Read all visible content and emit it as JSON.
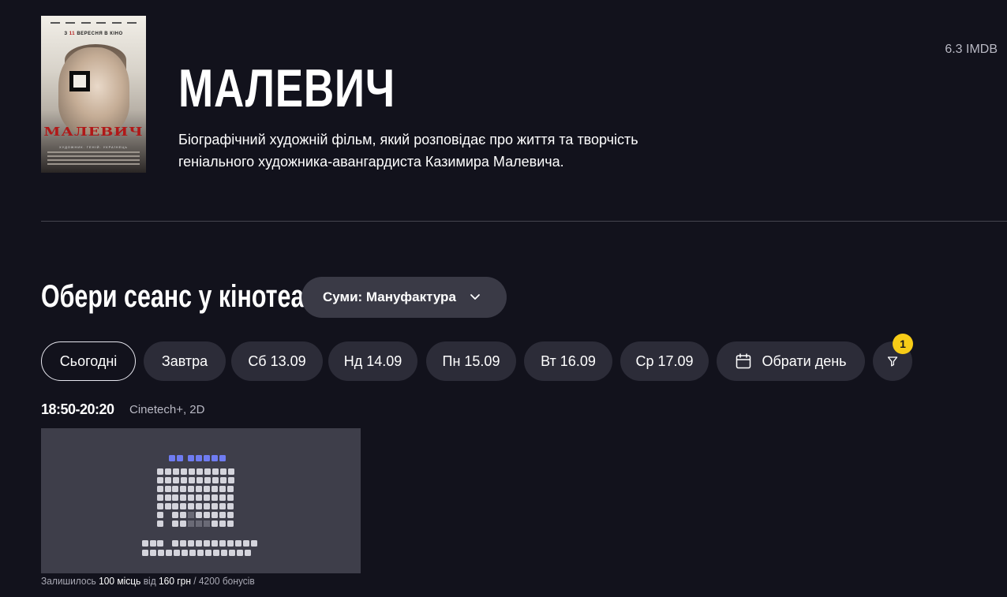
{
  "movie": {
    "title": "МАЛЕВИЧ",
    "description": "Біографічний художній фільм, який розповідає про життя та творчість геніального художника-авангардиста Казимира Малевича.",
    "rating": "6.3 IMDB",
    "poster": {
      "date_prefix": "З",
      "date_day": "11",
      "date_suffix": "ВЕРЕСНЯ В КІНО",
      "title": "МАЛЕВИЧ",
      "subtitle": "ХУДОЖНИК. ГЕНІЙ. УКРАЇНЕЦЬ"
    }
  },
  "sessions": {
    "heading": "Обери сеанс у кінотеатрі",
    "cinema": "Суми: Мануфактура",
    "days": [
      {
        "label": "Сьогодні",
        "active": true
      },
      {
        "label": "Завтра",
        "active": false
      },
      {
        "label": "Сб 13.09",
        "active": false
      },
      {
        "label": "Нд 14.09",
        "active": false
      },
      {
        "label": "Пн 15.09",
        "active": false
      },
      {
        "label": "Вт 16.09",
        "active": false
      },
      {
        "label": "Ср 17.09",
        "active": false
      }
    ],
    "pick_day": "Обрати день",
    "filter_count": "1",
    "items": [
      {
        "time": "18:50-20:20",
        "format": "Cinetech+, 2D",
        "availability": {
          "prefix": "Залишилось",
          "seats": "100 місць",
          "from": "від",
          "price": "160 грн",
          "bonus": "/ 4200 бонусів"
        }
      }
    ]
  },
  "colors": {
    "background": "#12121c",
    "chip": "#2c2c38",
    "badge": "#f7cc17",
    "seat_free": "#d4d4dc",
    "seat_taken": "#6a6a76",
    "seat_vip": "#6f7cf2"
  },
  "icons": [
    "chevron-down-icon",
    "calendar-icon",
    "filter-icon"
  ]
}
